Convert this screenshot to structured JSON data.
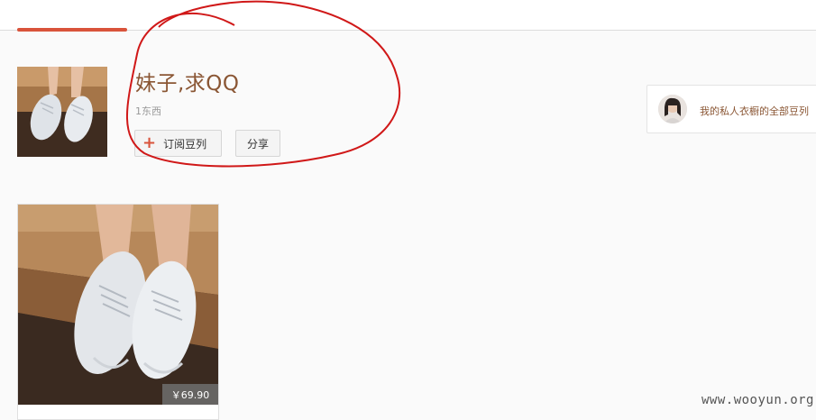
{
  "doulist": {
    "title": "妹子,求QQ",
    "item_count": "1东西",
    "subscribe_label": "订阅豆列",
    "subscribe_icon": "plus-icon",
    "share_label": "分享"
  },
  "owner": {
    "link_text": "我的私人衣橱的全部豆列"
  },
  "items": [
    {
      "price": "￥69.90"
    }
  ],
  "watermark": "www.wooyun.org",
  "colors": {
    "accent": "#d9533b",
    "title": "#8a5634",
    "annotation": "#d01818"
  }
}
